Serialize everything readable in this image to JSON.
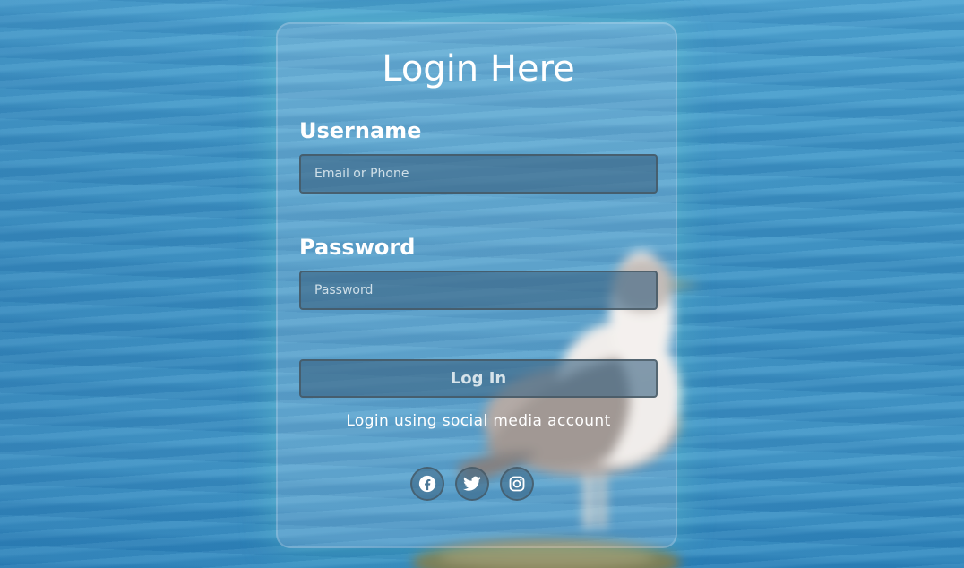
{
  "login_form": {
    "title": "Login Here",
    "username_label": "Username",
    "username_placeholder": "Email or Phone",
    "username_value": "",
    "password_label": "Password",
    "password_placeholder": "Password",
    "password_value": "",
    "submit_label": "Log In",
    "social_text": "Login using social media account"
  },
  "social_icons": [
    "facebook-icon",
    "twitter-icon",
    "instagram-icon"
  ],
  "colors": {
    "card_glow": "#78e6d2",
    "background_water": "#3f95c6",
    "text": "#ffffff"
  }
}
